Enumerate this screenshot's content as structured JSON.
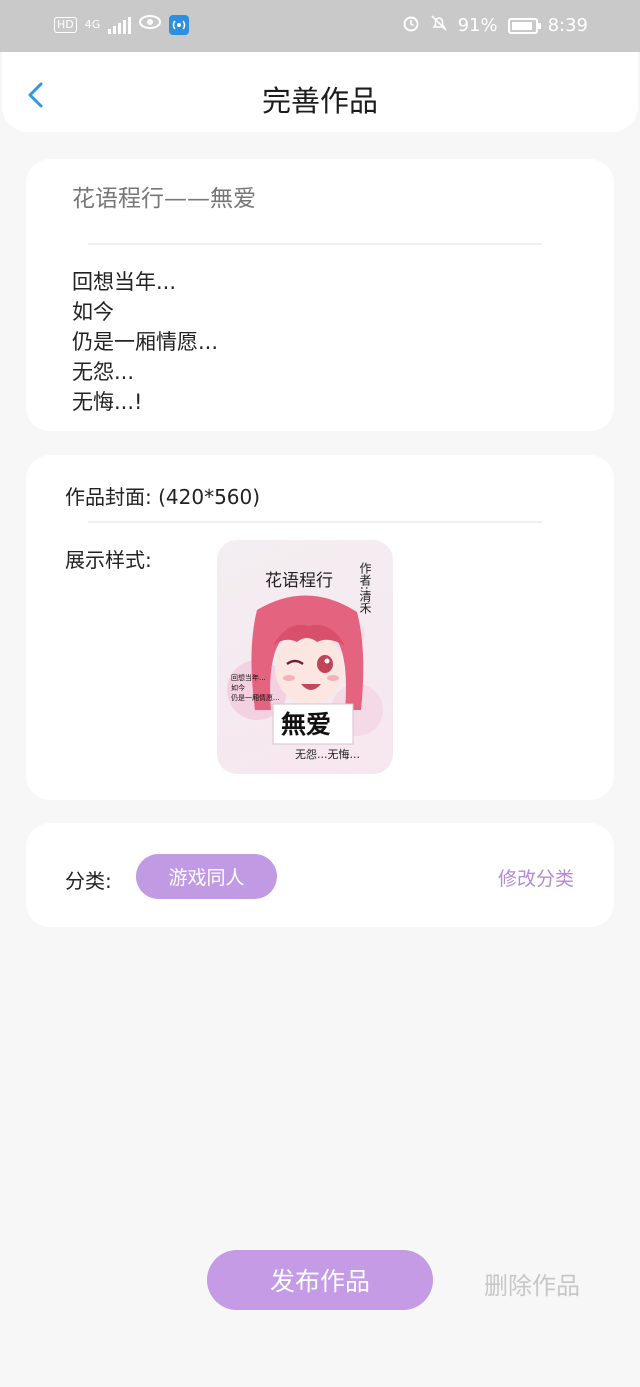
{
  "status_bar": {
    "hd": "HD",
    "net": "4G",
    "battery": "91%",
    "time": "8:39",
    "battery_level": 0.91,
    "icons": [
      "signal-icon",
      "eye-icon",
      "hotspot-icon",
      "alarm-icon",
      "mute-icon",
      "battery-icon"
    ]
  },
  "header": {
    "title": "完善作品",
    "back_icon": "chevron-left-icon"
  },
  "work": {
    "title": "花语程行——無爱",
    "poem_lines": [
      "回想当年...",
      "如今",
      "仍是一厢情愿...",
      "无怨...",
      "无悔...!"
    ]
  },
  "cover": {
    "label": "作品封面:  (420*560)",
    "style_label": "展示样式:",
    "art_text": {
      "title": "花语程行",
      "author_column": "作者:清禾",
      "side_lines": [
        "回想当年...",
        "如今",
        "仍是一厢情愿..."
      ],
      "big_word": "無爱",
      "footer": "无怨...无悔..."
    }
  },
  "category": {
    "label": "分类:",
    "value": "游戏同人",
    "edit_label": "修改分类"
  },
  "actions": {
    "publish": "发布作品",
    "delete": "删除作品"
  },
  "colors": {
    "accent": "#c49be4",
    "accent_text": "#b48ad8",
    "back_arrow": "#2f97e6",
    "background": "#f7f7f7"
  }
}
